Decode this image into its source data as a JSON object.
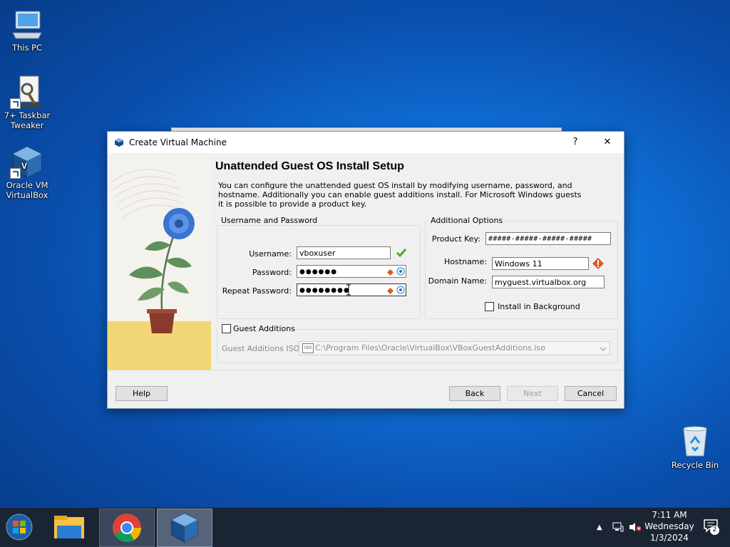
{
  "desktop": {
    "icons": [
      {
        "label": "This PC"
      },
      {
        "label": "7+ Taskbar Tweaker"
      },
      {
        "label": "Oracle VM VirtualBox"
      },
      {
        "label": "Recycle Bin"
      }
    ]
  },
  "dialog": {
    "title": "Create Virtual Machine",
    "help_glyph": "?",
    "close_glyph": "✕",
    "heading": "Unattended Guest OS Install Setup",
    "description": "You can configure the unattended guest OS install by modifying username, password, and hostname. Additionally you can enable guest additions install. For Microsoft Windows guests it is possible to provide a product key.",
    "user_group": {
      "title": "Username and Password",
      "username_label": "Username:",
      "username_value": "vboxuser",
      "password_label": "Password:",
      "password_value": "●●●●●●",
      "repeat_label": "Repeat Password:",
      "repeat_value": "●●●●●●●●"
    },
    "options_group": {
      "title": "Additional Options",
      "product_key_label": "Product Key:",
      "product_key_value": "#####-#####-#####-#####",
      "hostname_label": "Hostname:",
      "hostname_value": "Windows 11",
      "domain_label": "Domain Name:",
      "domain_value": "myguest.virtualbox.org",
      "install_bg_label": "Install in Background"
    },
    "guest_additions": {
      "label": "Guest Additions",
      "iso_label": "Guest Additions ISO:",
      "iso_value": "C:\\Program Files\\Oracle\\VirtualBox\\VBoxGuestAdditions.iso",
      "iso_badge": "ISO"
    },
    "buttons": {
      "help": "Help",
      "back": "Back",
      "next": "Next",
      "cancel": "Cancel"
    }
  },
  "taskbar": {
    "time": "7:11 AM",
    "day": "Wednesday",
    "date": "1/3/2024",
    "notification_count": "2"
  }
}
